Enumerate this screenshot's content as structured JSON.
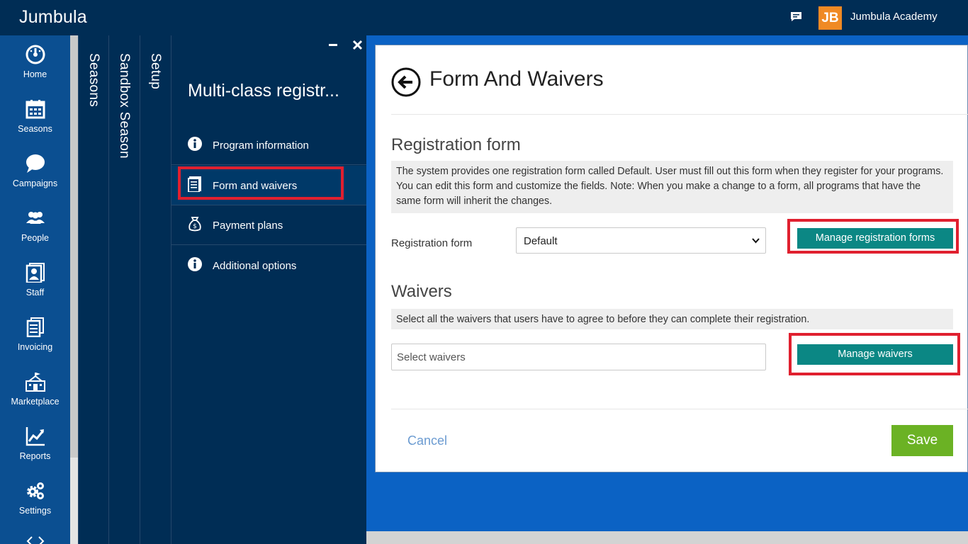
{
  "header": {
    "brand": "Jumbula",
    "org_logo_text": "JB",
    "org_name": "Jumbula Academy",
    "org_logo_color": "#f08a24"
  },
  "nav": {
    "items": [
      {
        "label": "Home",
        "icon": "dashboard-icon"
      },
      {
        "label": "Seasons",
        "icon": "calendar-icon"
      },
      {
        "label": "Campaigns",
        "icon": "chat-bubble-icon"
      },
      {
        "label": "People",
        "icon": "people-icon"
      },
      {
        "label": "Staff",
        "icon": "staff-badge-icon"
      },
      {
        "label": "Invoicing",
        "icon": "invoice-icon"
      },
      {
        "label": "Marketplace",
        "icon": "building-icon"
      },
      {
        "label": "Reports",
        "icon": "chart-line-icon"
      },
      {
        "label": "Settings",
        "icon": "gears-icon"
      }
    ]
  },
  "breadcrumbs": {
    "items": [
      "Seasons",
      "Sandbox Season",
      "Setup"
    ]
  },
  "subpanel": {
    "title": "Multi-class registr...",
    "items": [
      {
        "label": "Program information",
        "icon": "info-icon"
      },
      {
        "label": "Form and waivers",
        "icon": "document-icon",
        "active": true
      },
      {
        "label": "Payment plans",
        "icon": "money-bag-icon"
      },
      {
        "label": "Additional options",
        "icon": "info-icon"
      }
    ]
  },
  "main": {
    "title": "Form And Waivers",
    "registration": {
      "heading": "Registration form",
      "info": "The system provides one registration form called Default. User must fill out this form when they register for your programs. You can edit this form and customize the fields. Note: When you make a change to a form, all programs that have the same form will inherit the changes.",
      "field_label": "Registration form",
      "selected_value": "Default",
      "manage_button": "Manage registration forms"
    },
    "waivers": {
      "heading": "Waivers",
      "info": "Select all the waivers that users have to agree to before they can complete their registration.",
      "placeholder": "Select waivers",
      "manage_button": "Manage waivers"
    },
    "cancel_label": "Cancel",
    "save_label": "Save"
  },
  "colors": {
    "topbar": "#002d55",
    "nav": "#0b4f91",
    "accent_teal": "#0b8784",
    "save_green": "#6bb224",
    "highlight_red": "#e0202f"
  }
}
